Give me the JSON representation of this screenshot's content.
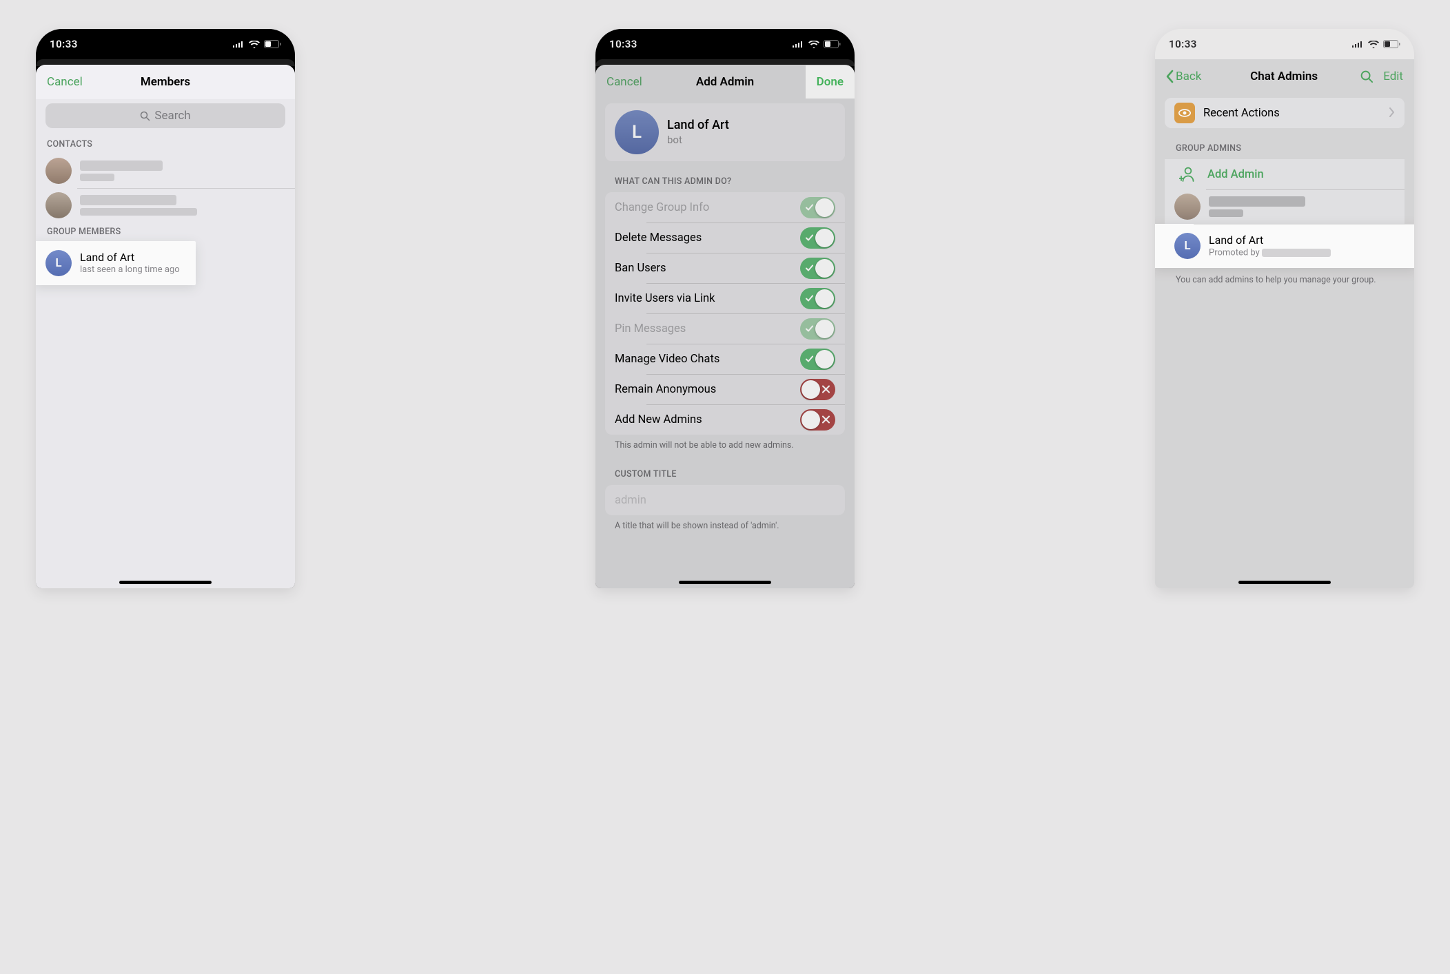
{
  "status": {
    "time": "10:33"
  },
  "screen1": {
    "cancel": "Cancel",
    "title": "Members",
    "search_placeholder": "Search",
    "contacts_header": "CONTACTS",
    "group_members_header": "GROUP MEMBERS",
    "member": {
      "name": "Land of Art",
      "sub": "last seen a long time ago",
      "initial": "L"
    }
  },
  "screen2": {
    "cancel": "Cancel",
    "title": "Add Admin",
    "done": "Done",
    "user": {
      "name": "Land of Art",
      "sub": "bot",
      "initial": "L"
    },
    "perm_header": "WHAT CAN THIS ADMIN DO?",
    "perms": [
      {
        "label": "Change Group Info",
        "state": "on-dim"
      },
      {
        "label": "Delete Messages",
        "state": "on"
      },
      {
        "label": "Ban Users",
        "state": "on"
      },
      {
        "label": "Invite Users via Link",
        "state": "on"
      },
      {
        "label": "Pin Messages",
        "state": "on-dim"
      },
      {
        "label": "Manage Video Chats",
        "state": "on"
      },
      {
        "label": "Remain Anonymous",
        "state": "off-red"
      },
      {
        "label": "Add New Admins",
        "state": "off-red"
      }
    ],
    "perm_footer": "This admin will not be able to add new admins.",
    "custom_title_header": "CUSTOM TITLE",
    "custom_title_placeholder": "admin",
    "custom_title_footer": "A title that will be shown instead of 'admin'."
  },
  "screen3": {
    "back": "Back",
    "title": "Chat Admins",
    "edit": "Edit",
    "recent_actions": "Recent Actions",
    "group_admins_header": "GROUP ADMINS",
    "add_admin": "Add Admin",
    "admin": {
      "name": "Land of Art",
      "sub_prefix": "Promoted by ",
      "initial": "L"
    },
    "footer": "You can add admins to help you manage your group."
  }
}
